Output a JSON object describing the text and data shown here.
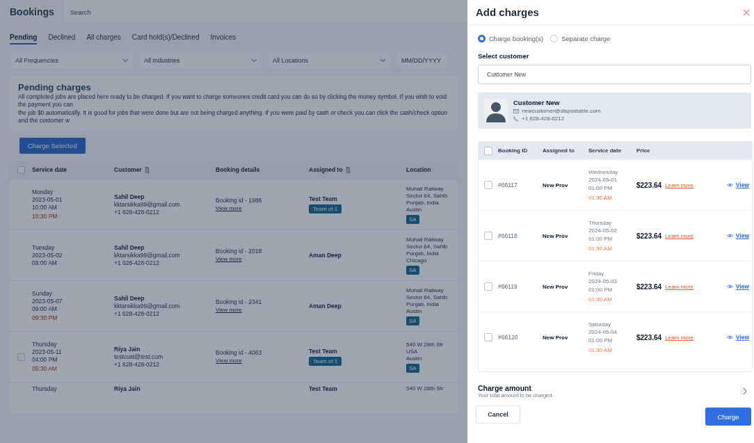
{
  "page": {
    "title": "Bookings",
    "search": {
      "placeholder": "Search"
    },
    "tabs": [
      {
        "label": "Pending",
        "selected": true
      },
      {
        "label": "Declined",
        "selected": false
      },
      {
        "label": "All charges",
        "selected": false
      },
      {
        "label": "Card hold(s)/Declined",
        "selected": false
      },
      {
        "label": "Invoices",
        "selected": false
      }
    ],
    "filters": [
      {
        "kind": "select",
        "placeholder": "All Frequencies"
      },
      {
        "kind": "select",
        "placeholder": "All Industries"
      },
      {
        "kind": "select",
        "placeholder": "All Locations"
      },
      {
        "kind": "date",
        "placeholder": "MM/DD/YYYY"
      }
    ],
    "section": {
      "title": "Pending charges",
      "lines": [
        "All completed jobs are placed here ready to be charged. If you want to charge someones credit card you can do so by clicking the money symbol. If you wish to void the payment you can",
        "the job $0 automatically. It is good for jobs that were done but are not being charged anything. If you were paid by cash or check you can click the cash/check option and the customer w"
      ]
    },
    "charge_selected": "Charge Selected",
    "table": {
      "all_checked": false,
      "columns": [
        {
          "label": "Service date",
          "sortable": false
        },
        {
          "label": "Customer",
          "sortable": true
        },
        {
          "label": "Booking details",
          "sortable": false
        },
        {
          "label": "Assigned to",
          "sortable": true
        },
        {
          "label": "Location",
          "sortable": false
        }
      ],
      "rows": [
        {
          "day": "Monday",
          "date": "2023-05-01",
          "time": "10:00 AM",
          "end_time": "10:30 PM",
          "customer": {
            "name": "Sahil Deep",
            "email": "kktarsikka99@gmail.com",
            "phone": "+1 628-428-0212"
          },
          "booking": "Booking id - 1986",
          "view_more": "View more",
          "assigned": "Test Team",
          "team_badge": "Team of 1",
          "location": [
            "Mohali Railway",
            "Sector 64, Sahib",
            "Punjab, India",
            "Austin"
          ],
          "location_badge": "SA"
        },
        {
          "day": "Tuesday",
          "date": "2023-05-02",
          "time": "09:00 AM",
          "customer": {
            "name": "Sahil Deep",
            "email": "kktarsikka99@gmail.com",
            "phone": "+1 628-428-0212"
          },
          "booking": "Booking id - 2018",
          "view_more": "View more",
          "assigned": "Aman Deep",
          "location": [
            "Mohali Railway",
            "Sector 64, Sahib",
            "Punjab, India",
            "Chicago"
          ],
          "location_badge": "SA"
        },
        {
          "day": "Sunday",
          "date": "2023-05-07",
          "time": "09:00 AM",
          "end_time": "09:30 PM",
          "customer": {
            "name": "Sahil Deep",
            "email": "kktarsikka99@gmail.com",
            "phone": "+1 628-428-0212"
          },
          "booking": "Booking id - 2341",
          "view_more": "View more",
          "assigned": "Aman Deep",
          "location": [
            "Mohali Railway",
            "Sector 64, Sahib",
            "Punjab, India",
            "Austin"
          ],
          "location_badge": "SA"
        },
        {
          "checked": false,
          "day": "Thursday",
          "date": "2023-05-11",
          "time": "04:00 PM",
          "end_time": "05:30 AM",
          "customer": {
            "name": "Riya Jain",
            "email": "testcust@test.com",
            "phone": "+1 628-428-0212"
          },
          "booking": "Booking id - 4063",
          "view_more": "View more",
          "assigned": "Test Team",
          "team_badge": "Team of 1",
          "location": [
            "540 W 28th Str",
            "USA",
            "Austin"
          ],
          "location_badge": "SA"
        },
        {
          "day": "Thursday",
          "customer": {
            "name": "Riya Jain"
          },
          "assigned": "Test Team",
          "location": [
            "540 W 28th Str"
          ]
        }
      ]
    }
  },
  "drawer": {
    "title": "Add charges",
    "modes": [
      {
        "label": "Charge booking(s)",
        "selected": true
      },
      {
        "label": "Separate charge",
        "selected": false
      }
    ],
    "customer_label": "Select customer",
    "customer_field": {
      "value": "Customer New"
    },
    "customer_card": {
      "name": "Customer New",
      "email": "newcustomer@dispostable.com",
      "phone": "+1 628-428-0212"
    },
    "bookings": {
      "all_checked": false,
      "columns": [
        "Booking ID",
        "Assigned to",
        "Service date",
        "Price"
      ],
      "rows": [
        {
          "checked": false,
          "id": "#66117",
          "assigned": "New Prov",
          "day": "Wednesday",
          "date": "2024-05-01",
          "time": "01:00 PM",
          "end_time": "01:30 AM",
          "price": "$223.64",
          "learn_more": "Learn more",
          "view": "View"
        },
        {
          "checked": false,
          "id": "#66118",
          "assigned": "New Prov",
          "day": "Thursday",
          "date": "2024-05-02",
          "time": "01:00 PM",
          "end_time": "01:30 AM",
          "price": "$223.64",
          "learn_more": "Learn more",
          "view": "View"
        },
        {
          "checked": false,
          "id": "#66119",
          "assigned": "New Prov",
          "day": "Friday",
          "date": "2024-05-03",
          "time": "01:00 PM",
          "end_time": "01:30 AM",
          "price": "$223.64",
          "learn_more": "Learn more",
          "view": "View"
        },
        {
          "checked": false,
          "id": "#66120",
          "assigned": "New Prov",
          "day": "Saturday",
          "date": "2024-05-04",
          "time": "01:00 PM",
          "end_time": "01:30 AM",
          "price": "$223.64",
          "learn_more": "Learn more",
          "view": "View"
        }
      ]
    },
    "charge_amount": {
      "title": "Charge amount",
      "subtitle": "Your total amount to be charged."
    },
    "buttons": {
      "cancel": "Cancel",
      "charge": "Charge"
    }
  }
}
